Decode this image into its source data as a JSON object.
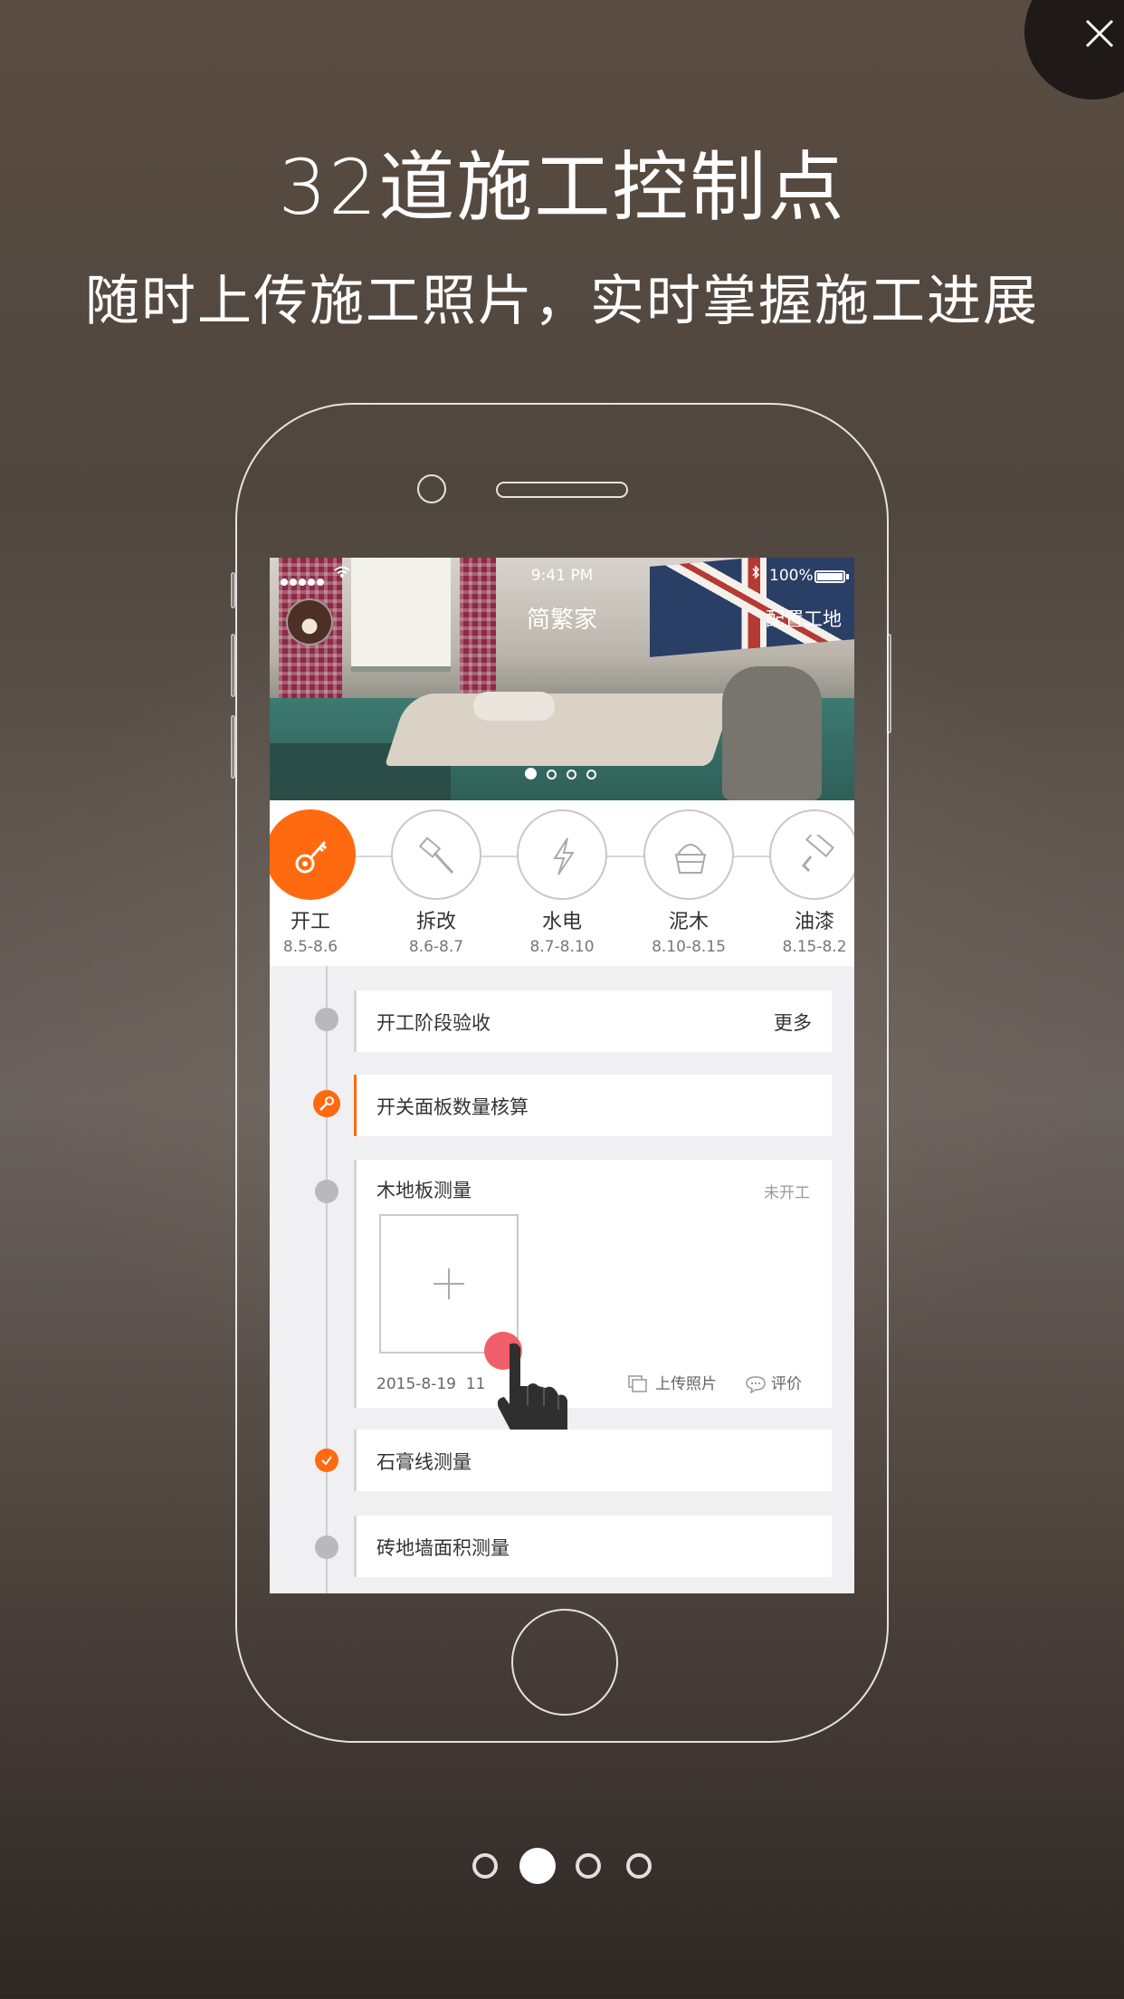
{
  "headline": "32道施工控制点",
  "subheadline": "随时上传施工照片，实时掌握施工进展",
  "phone": {
    "status_bar": {
      "time": "9:41 PM",
      "battery": "100%"
    },
    "app_title": "简繁家",
    "config_link": "配置工地",
    "stages": [
      {
        "name": "开工",
        "date": "8.5-8.6",
        "icon": "key-icon",
        "active": true
      },
      {
        "name": "拆改",
        "date": "8.6-8.7",
        "icon": "hammer-icon",
        "active": false
      },
      {
        "name": "水电",
        "date": "8.7-8.10",
        "icon": "lightning-icon",
        "active": false
      },
      {
        "name": "泥木",
        "date": "8.10-8.15",
        "icon": "bucket-icon",
        "active": false
      },
      {
        "name": "油漆",
        "date": "8.15-8.2",
        "icon": "paint-roller-icon",
        "active": false
      }
    ],
    "tasks": [
      {
        "title": "开工阶段验收",
        "more": "更多"
      },
      {
        "title": "开关面板数量核算"
      },
      {
        "title": "木地板测量",
        "status": "未开工",
        "date": "2015-8-19",
        "time": "11",
        "upload_label": "上传照片",
        "comment_label": "评价"
      },
      {
        "title": "石膏线测量"
      },
      {
        "title": "砖地墙面积测量"
      }
    ]
  },
  "colors": {
    "accent": "#ff6a10",
    "node_gray": "#b9b9bb"
  },
  "page_indicator": {
    "count": 4,
    "active_index": 1
  }
}
